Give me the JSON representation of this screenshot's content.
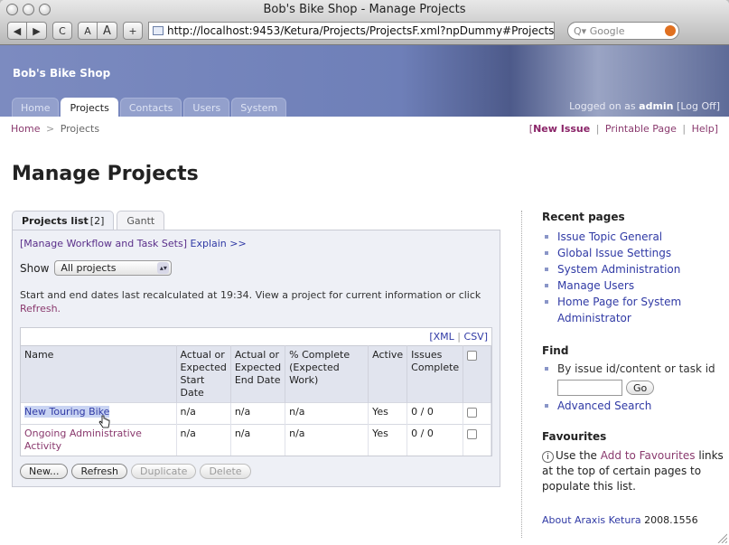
{
  "window": {
    "title": "Bob's Bike Shop - Manage Projects",
    "url": "http://localhost:9453/Ketura/Projects/ProjectsF.xml?npDummy#Projects",
    "search_placeholder": "Google",
    "toolbar": {
      "back": "◀",
      "forward": "▶",
      "reload": "C",
      "text_smaller": "A",
      "text_bigger": "A",
      "add": "+"
    }
  },
  "header": {
    "shop_name": "Bob's Bike Shop",
    "tabs": [
      {
        "label": "Home"
      },
      {
        "label": "Projects"
      },
      {
        "label": "Contacts"
      },
      {
        "label": "Users"
      },
      {
        "label": "System"
      }
    ],
    "logged_in_prefix": "Logged on as",
    "logged_in_user": "admin",
    "logout_label": "[Log Off]"
  },
  "breadcrumb": {
    "home": "Home",
    "separator": ">",
    "current": "Projects"
  },
  "top_links": {
    "new_issue": "New Issue",
    "printable": "Printable Page",
    "help": "Help",
    "open": "[",
    "close": "]",
    "bar": "|"
  },
  "page_title": "Manage Projects",
  "subtabs": [
    {
      "label": "Projects list",
      "count": "[2]"
    },
    {
      "label": "Gantt"
    }
  ],
  "panel": {
    "manage_link": "[Manage Workflow and Task Sets]",
    "explain_link": "Explain >>",
    "show_label": "Show",
    "show_value": "All projects",
    "recalc_text": "Start and end dates last recalculated at 19:34. View a project for current information or click",
    "refresh_text": "Refresh."
  },
  "export": {
    "xml": "[XML",
    "bar": "|",
    "csv": "CSV]"
  },
  "table": {
    "headers": {
      "name": "Name",
      "start": "Actual or Expected Start Date",
      "end": "Actual or Expected End Date",
      "complete": "% Complete (Expected Work)",
      "active": "Active",
      "issues": "Issues Complete"
    },
    "rows": [
      {
        "name": "New Touring Bike",
        "start": "n/a",
        "end": "n/a",
        "complete": "n/a",
        "active": "Yes",
        "issues": "0 / 0"
      },
      {
        "name": "Ongoing Administrative Activity",
        "start": "n/a",
        "end": "n/a",
        "complete": "n/a",
        "active": "Yes",
        "issues": "0 / 0"
      }
    ]
  },
  "buttons": {
    "new": "New...",
    "refresh": "Refresh",
    "duplicate": "Duplicate",
    "delete": "Delete"
  },
  "sidebar": {
    "recent_title": "Recent pages",
    "recent": [
      "Issue Topic General",
      "Global Issue Settings",
      "System Administration",
      "Manage Users",
      "Home Page for System Administrator"
    ],
    "find_title": "Find",
    "find_label": "By issue id/content or task id",
    "go": "Go",
    "advanced": "Advanced Search",
    "fav_title": "Favourites",
    "fav_prefix": "Use the",
    "fav_link": "Add to Favourites",
    "fav_suffix": "links at the top of certain pages to populate this list.",
    "about_link": "About Araxis Ketura",
    "version": "2008.1556"
  }
}
